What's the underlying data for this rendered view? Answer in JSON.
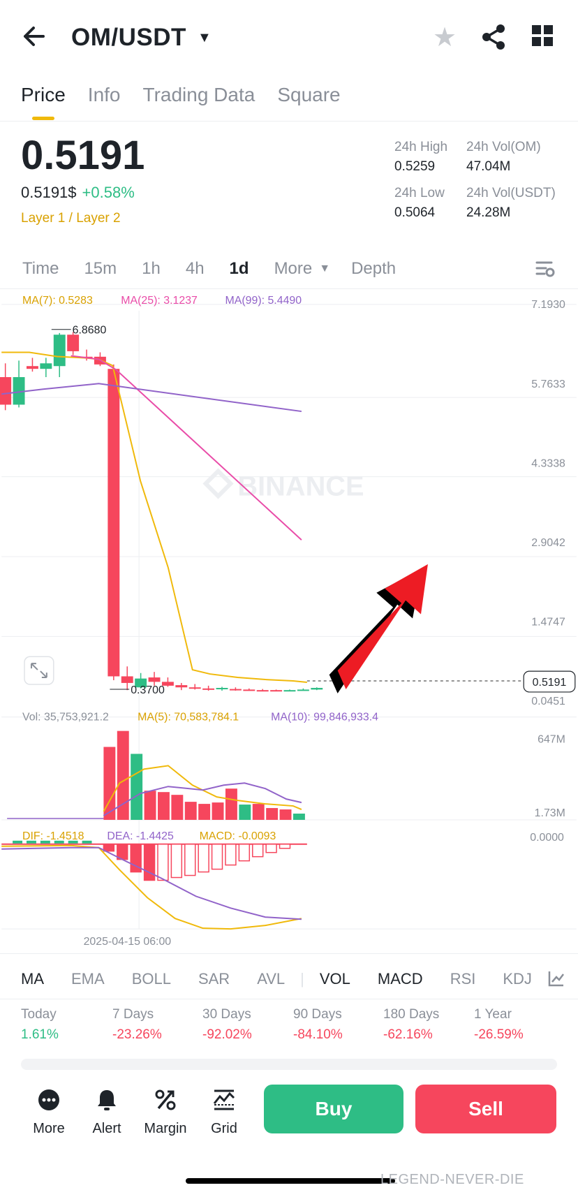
{
  "header": {
    "pair": "OM/USDT",
    "back_icon": "arrow-left-icon",
    "star_icon": "star-icon",
    "share_icon": "share-icon",
    "grid_icon": "grid-icon"
  },
  "tabs": [
    "Price",
    "Info",
    "Trading Data",
    "Square"
  ],
  "price": {
    "last": "0.5191",
    "usd": "0.5191$",
    "change": "+0.58%",
    "tag": "Layer 1 / Layer 2",
    "stats": [
      {
        "label": "24h High",
        "value": "0.5259"
      },
      {
        "label": "24h Vol(OM)",
        "value": "47.04M"
      },
      {
        "label": "24h Low",
        "value": "0.5064"
      },
      {
        "label": "24h Vol(USDT)",
        "value": "24.28M"
      }
    ]
  },
  "timeframes": [
    "Time",
    "15m",
    "1h",
    "4h",
    "1d",
    "More",
    "Depth"
  ],
  "selected_timeframe": "1d",
  "chart_data": {
    "type": "candlestick",
    "ma_legend": {
      "ma7": "MA(7): 0.5283",
      "ma25": "MA(25): 3.1237",
      "ma99": "MA(99): 5.4490"
    },
    "y_ticks": [
      "7.1930",
      "5.7633",
      "4.3338",
      "2.9042",
      "1.4747",
      "0.0451"
    ],
    "high_label": "6.8680",
    "low_label": "0.3700",
    "current_price_label": "0.5191",
    "watermark": "BINANCE",
    "volume_legend": {
      "vol": "Vol: 35,753,921.2",
      "ma5": "MA(5): 70,583,784.1",
      "ma10": "MA(10): 99,846,933.4"
    },
    "volume_ticks": [
      "647M",
      "1.73M"
    ],
    "macd_legend": {
      "dif": "DIF: -1.4518",
      "dea": "DEA: -1.4425",
      "macd": "MACD: -0.0093"
    },
    "macd_tick": "0.0000",
    "x_label": "2025-04-15 06:00",
    "colors": {
      "up": "#2ebd85",
      "down": "#f6465d",
      "ma7": "#f0b90b",
      "ma25": "#e94ca8",
      "ma99": "#9163c9"
    }
  },
  "indicators": [
    "MA",
    "EMA",
    "BOLL",
    "SAR",
    "AVL",
    "VOL",
    "MACD",
    "RSI",
    "KDJ"
  ],
  "performance": [
    {
      "label": "Today",
      "value": "1.61%"
    },
    {
      "label": "7 Days",
      "value": "-23.26%"
    },
    {
      "label": "30 Days",
      "value": "-92.02%"
    },
    {
      "label": "90 Days",
      "value": "-84.10%"
    },
    {
      "label": "180 Days",
      "value": "-62.16%"
    },
    {
      "label": "1 Year",
      "value": "-26.59%"
    }
  ],
  "bottom_bar": {
    "items": [
      "More",
      "Alert",
      "Margin",
      "Grid"
    ],
    "buy": "Buy",
    "sell": "Sell"
  },
  "overlay_watermark": "LEGEND-NEVER-DIE"
}
